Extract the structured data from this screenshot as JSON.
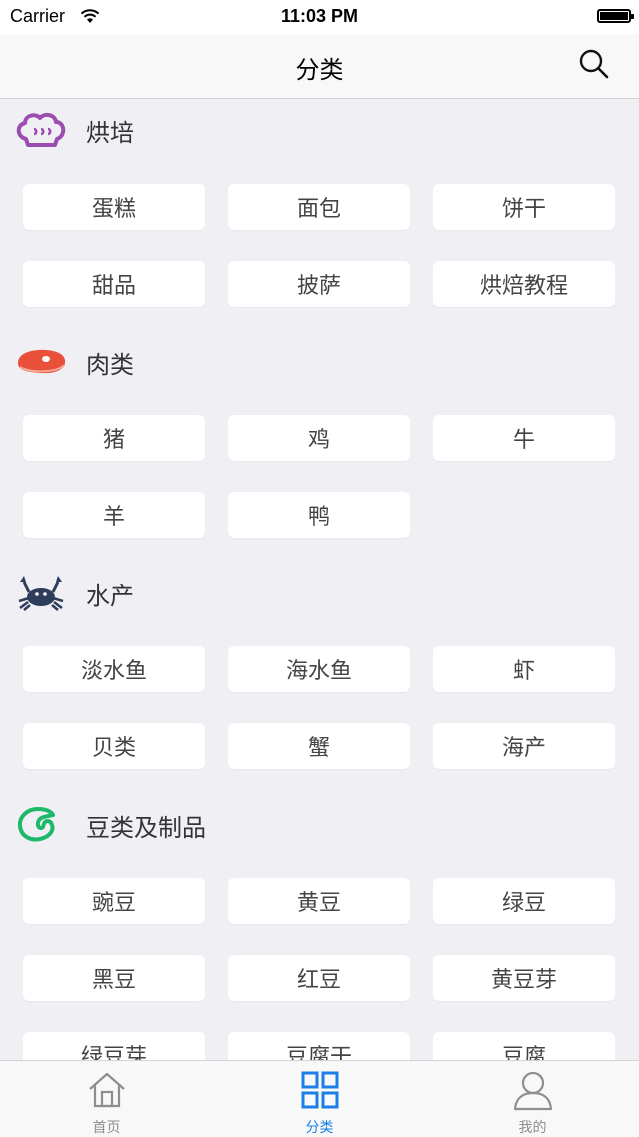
{
  "status_bar": {
    "carrier": "Carrier",
    "time": "11:03 PM"
  },
  "nav": {
    "title": "分类"
  },
  "sections": [
    {
      "title": "烘培",
      "icon": "chef-hat-icon",
      "items": [
        "蛋糕",
        "面包",
        "饼干",
        "甜品",
        "披萨",
        "烘焙教程"
      ]
    },
    {
      "title": "肉类",
      "icon": "steak-icon",
      "items": [
        "猪",
        "鸡",
        "牛",
        "羊",
        "鸭"
      ]
    },
    {
      "title": "水产",
      "icon": "crab-icon",
      "items": [
        "淡水鱼",
        "海水鱼",
        "虾",
        "贝类",
        "蟹",
        "海产"
      ]
    },
    {
      "title": "豆类及制品",
      "icon": "bean-icon",
      "items": [
        "豌豆",
        "黄豆",
        "绿豆",
        "黑豆",
        "红豆",
        "黄豆芽",
        "绿豆芽",
        "豆腐干",
        "豆腐"
      ]
    }
  ],
  "tabbar": [
    {
      "label": "首页",
      "icon": "home-icon",
      "active": false
    },
    {
      "label": "分类",
      "icon": "grid-icon",
      "active": true
    },
    {
      "label": "我的",
      "icon": "user-icon",
      "active": false
    }
  ],
  "colors": {
    "accent": "#1a7ee6",
    "baking": "#9b4db0",
    "meat": "#e8503a",
    "seafood": "#2e3d5a",
    "beans": "#1db86a"
  }
}
